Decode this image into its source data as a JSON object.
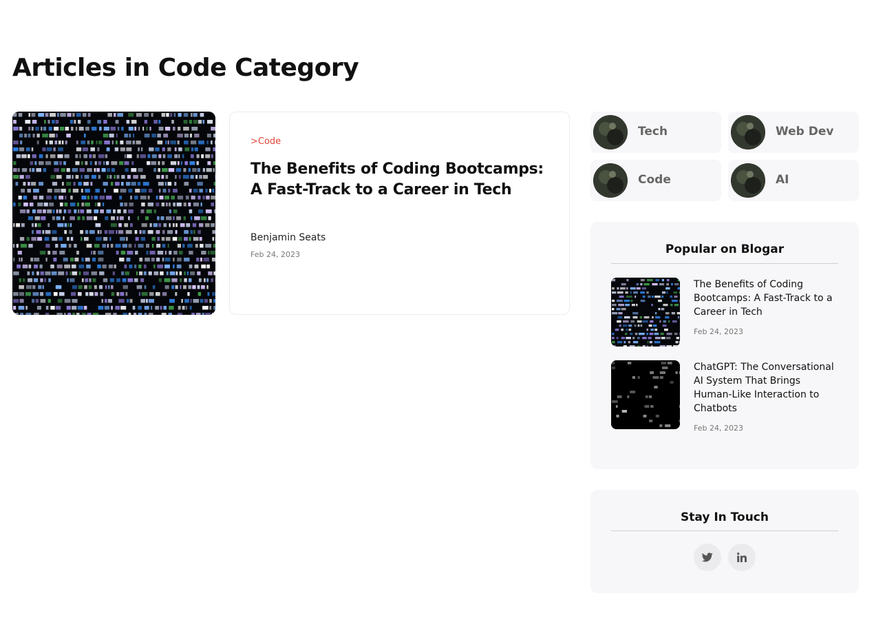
{
  "page": {
    "title": "Articles in Code Category"
  },
  "article": {
    "category": ">Code",
    "title": "The Benefits of Coding Bootcamps: A Fast-Track to a Career in Tech",
    "author": "Benjamin Seats",
    "date": "Feb 24, 2023"
  },
  "categories": [
    {
      "label": "Tech"
    },
    {
      "label": "Web Dev"
    },
    {
      "label": "Code"
    },
    {
      "label": "AI"
    }
  ],
  "popular": {
    "heading": "Popular on Blogar",
    "items": [
      {
        "title": "The Benefits of Coding Bootcamps: A Fast-Track to a Career in Tech",
        "date": "Feb 24, 2023"
      },
      {
        "title": "ChatGPT: The Conversational AI System That Brings Human-Like Interaction to Chatbots",
        "date": "Feb 24, 2023"
      }
    ]
  },
  "stay_in_touch": {
    "heading": "Stay In Touch",
    "social": [
      {
        "icon": "twitter-icon"
      },
      {
        "icon": "linkedin-icon"
      }
    ]
  },
  "colors": {
    "category_accent": "#e0463a",
    "panel_bg": "#f7f7f9",
    "tile_label": "#666666"
  }
}
